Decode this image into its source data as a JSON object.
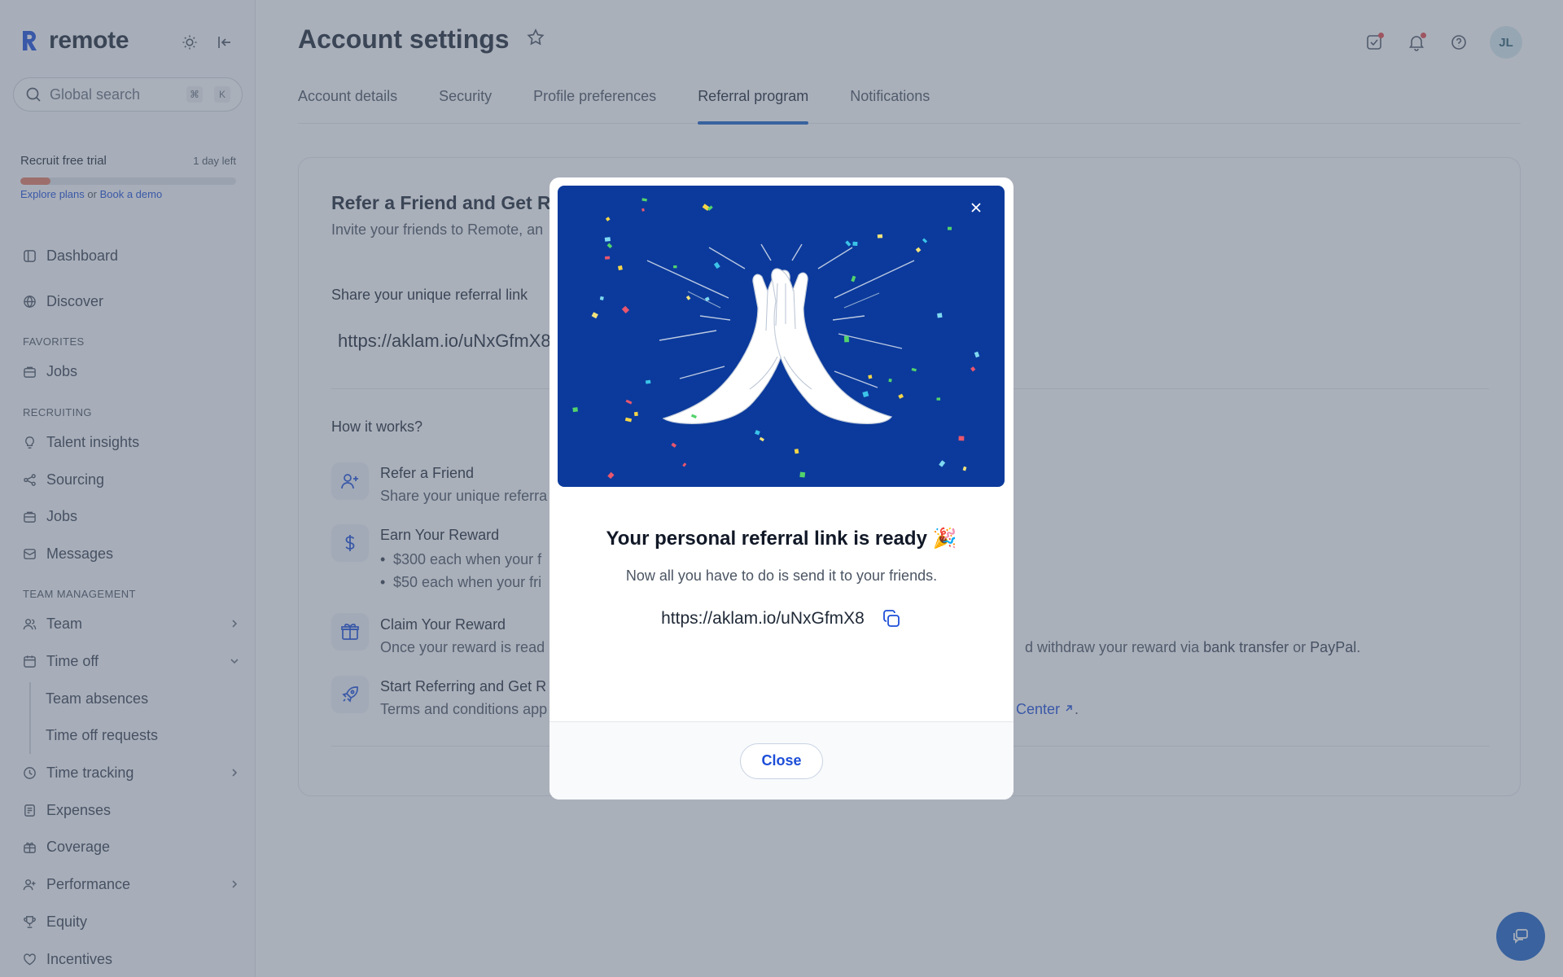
{
  "app": {
    "brand_name": "remote",
    "colors": {
      "accent": "#1d63c7",
      "hero_background": "#0b3a9c",
      "trial_fill": "#e27a62"
    }
  },
  "sidebar": {
    "theme_toggle_icon": "sun-icon",
    "collapse_icon": "collapse-sidebar-icon",
    "search": {
      "placeholder": "Global search",
      "shortcut_keys": [
        "⌘",
        "K"
      ]
    },
    "trial": {
      "title": "Recruit free trial",
      "days_left": "1 day left",
      "progress_fraction": 0.14,
      "explore_label": "Explore plans",
      "or_label": "or",
      "demo_label": "Book a demo"
    },
    "items": {
      "dashboard": "Dashboard",
      "discover": "Discover",
      "favorites_heading": "FAVORITES",
      "fav_jobs": "Jobs",
      "recruiting_heading": "RECRUITING",
      "talent_insights": "Talent insights",
      "sourcing": "Sourcing",
      "jobs": "Jobs",
      "messages": "Messages",
      "team_heading": "TEAM MANAGEMENT",
      "team": "Team",
      "time_off": "Time off",
      "team_absences": "Team absences",
      "time_off_requests": "Time off requests",
      "time_tracking": "Time tracking",
      "expenses": "Expenses",
      "coverage": "Coverage",
      "performance": "Performance",
      "equity": "Equity",
      "incentives": "Incentives"
    }
  },
  "header": {
    "title": "Account settings",
    "avatar_initials": "JL"
  },
  "tabs": [
    "Account details",
    "Security",
    "Profile preferences",
    "Referral program",
    "Notifications"
  ],
  "active_tab": "Referral program",
  "referral": {
    "title_visible": "Refer a Friend and Get Re",
    "subtitle_visible": "Invite your friends to Remote, an",
    "share_label": "Share your unique referral link",
    "link_visible": "https://aklam.io/uNxGfmX8",
    "how_label": "How it works?",
    "steps": [
      {
        "title": "Refer a Friend",
        "text": "Share your unique referra"
      },
      {
        "title": "Earn Your Reward",
        "bullets": [
          "$300 each when your f",
          "$50 each when your fri"
        ]
      },
      {
        "title": "Claim Your Reward",
        "text_left": "Once your reward is read",
        "text_right_prefix": "d withdraw your reward via ",
        "bank": "bank transfer",
        "or": " or ",
        "paypal": "PayPal",
        "end": "."
      },
      {
        "title": "Start Referring and Get R",
        "text_left": "Terms and conditions app",
        "link_right": "Center",
        "end": "."
      }
    ]
  },
  "modal": {
    "title": "Your personal referral link is ready 🎉",
    "description": "Now all you have to do is send it to your friends.",
    "link": "https://aklam.io/uNxGfmX8",
    "close_label": "Close"
  }
}
